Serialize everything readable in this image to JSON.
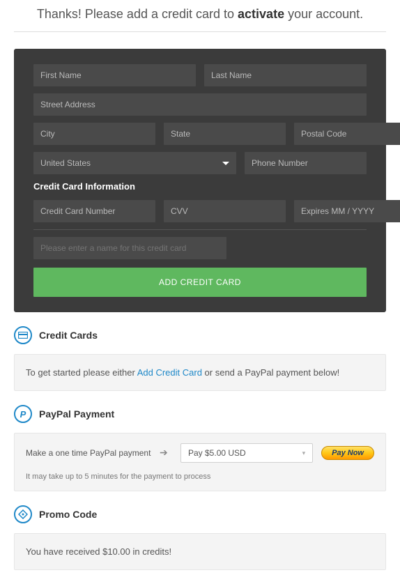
{
  "header": {
    "prefix": "Thanks! Please add a credit card to ",
    "strong": "activate",
    "suffix": " your account."
  },
  "form": {
    "first_name_ph": "First Name",
    "last_name_ph": "Last Name",
    "street_ph": "Street Address",
    "city_ph": "City",
    "state_ph": "State",
    "postal_ph": "Postal Code",
    "country_value": "United States",
    "phone_ph": "Phone Number",
    "cc_section_label": "Credit Card Information",
    "cc_number_ph": "Credit Card Number",
    "cvv_ph": "CVV",
    "expires_ph": "Expires MM / YYYY",
    "card_name_ph": "Please enter a name for this credit card",
    "add_btn_label": "ADD CREDIT CARD"
  },
  "credit_cards": {
    "title": "Credit Cards",
    "notice_prefix": "To get started please either ",
    "notice_link": "Add Credit Card",
    "notice_suffix": " or send a PayPal payment below!"
  },
  "paypal": {
    "title": "PayPal Payment",
    "icon_letter": "P",
    "label": "Make a one time PayPal payment",
    "selected": "Pay $5.00 USD",
    "paynow_label": "Pay Now",
    "note": "It may take up to 5 minutes for the payment to process"
  },
  "promo": {
    "title": "Promo Code",
    "notice": "You have received $10.00 in credits!"
  }
}
